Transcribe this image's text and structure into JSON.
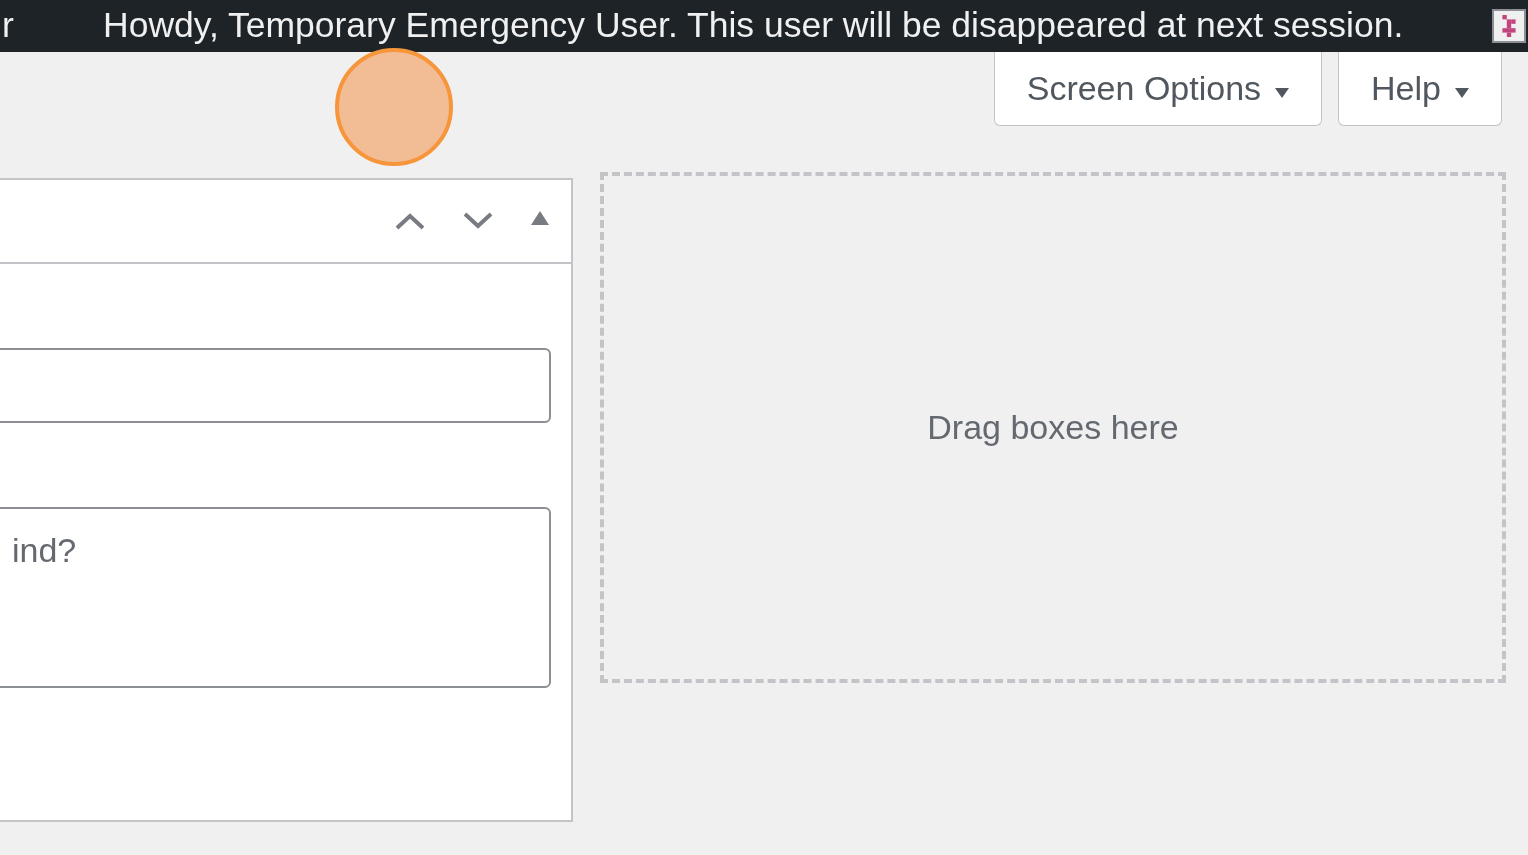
{
  "admin_bar": {
    "left_text": "r",
    "greeting": "Howdy, Temporary Emergency User. This user will be disappeared at next session."
  },
  "screen_meta_links": [
    {
      "label": "Screen Options",
      "expanded": false
    },
    {
      "label": "Help",
      "expanded": false
    }
  ],
  "widget": {
    "controls": [
      {
        "kind": "up"
      },
      {
        "kind": "down"
      },
      {
        "kind": "toggle"
      }
    ],
    "content_field": {
      "placeholder": "ind?"
    }
  },
  "drop_zone": {
    "text": "Drag boxes here"
  },
  "click_marker": {
    "kind": "click"
  }
}
